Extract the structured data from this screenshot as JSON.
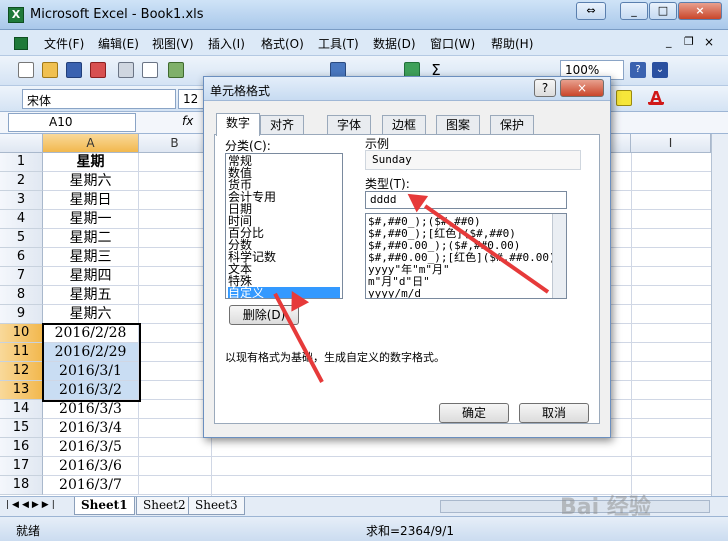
{
  "window": {
    "title": "Microsoft Excel - Book1.xls",
    "buttons": [
      "⇔",
      "_",
      "□",
      "×"
    ]
  },
  "menubar": {
    "items": [
      "文件(F)",
      "编辑(E)",
      "视图(V)",
      "插入(I)",
      "格式(O)",
      "工具(T)",
      "数据(D)",
      "窗口(W)",
      "帮助(H)"
    ]
  },
  "toolbar": {
    "zoom": "100%",
    "font_name": "宋体",
    "font_size": "12"
  },
  "formula": {
    "name_box": "A10",
    "fx": "fx"
  },
  "columns": [
    "A",
    "B",
    "I"
  ],
  "rows": [
    {
      "n": "1",
      "v": "星期"
    },
    {
      "n": "2",
      "v": "星期六"
    },
    {
      "n": "3",
      "v": "星期日"
    },
    {
      "n": "4",
      "v": "星期一"
    },
    {
      "n": "5",
      "v": "星期二"
    },
    {
      "n": "6",
      "v": "星期三"
    },
    {
      "n": "7",
      "v": "星期四"
    },
    {
      "n": "8",
      "v": "星期五"
    },
    {
      "n": "9",
      "v": "星期六"
    },
    {
      "n": "10",
      "v": "2016/2/28"
    },
    {
      "n": "11",
      "v": "2016/2/29"
    },
    {
      "n": "12",
      "v": "2016/3/1"
    },
    {
      "n": "13",
      "v": "2016/3/2"
    },
    {
      "n": "14",
      "v": "2016/3/3"
    },
    {
      "n": "15",
      "v": "2016/3/4"
    },
    {
      "n": "16",
      "v": "2016/3/5"
    },
    {
      "n": "17",
      "v": "2016/3/6"
    },
    {
      "n": "18",
      "v": "2016/3/7"
    }
  ],
  "sheets": [
    "Sheet1",
    "Sheet2",
    "Sheet3"
  ],
  "status": {
    "ready": "就绪",
    "sum": "求和=2364/9/1",
    "watermark": "Bai 经验"
  },
  "dialog": {
    "title": "单元格格式",
    "help": "?",
    "close": "×",
    "tabs": [
      "数字",
      "对齐",
      "字体",
      "边框",
      "图案",
      "保护"
    ],
    "category_label": "分类(C):",
    "categories": [
      "常规",
      "数值",
      "货币",
      "会计专用",
      "日期",
      "时间",
      "百分比",
      "分数",
      "科学记数",
      "文本",
      "特殊",
      "自定义"
    ],
    "sample_label": "示例",
    "sample_value": "Sunday",
    "type_label": "类型(T):",
    "type_value": "dddd",
    "formats": [
      "$#,##0_);($#,##0)",
      "$#,##0_);[红色]($#,##0)",
      "$#,##0.00_);($#,##0.00)",
      "$#,##0.00_);[红色]($#,##0.00)",
      "yyyy\"年\"m\"月\"",
      "m\"月\"d\"日\"",
      "yyyy/m/d"
    ],
    "delete_button": "删除(D)",
    "hint": "以现有格式为基础，生成自定义的数字格式。",
    "ok": "确定",
    "cancel": "取消"
  },
  "colors": {
    "accent": "#3399ff",
    "selection": "#c9ddf3",
    "arrow": "#e63a3a"
  }
}
